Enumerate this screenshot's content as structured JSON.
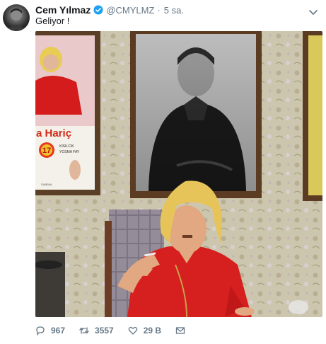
{
  "tweet": {
    "author_name": "Cem Yılmaz",
    "handle": "@CMYLMZ",
    "separator": "·",
    "time": "5 sa.",
    "text": "Geliyor !"
  },
  "media": {
    "poster_text_left": "a Hariç",
    "poster_number": "17",
    "poster_small_1": "KISILCIK",
    "poster_small_2": "YOSMA FAY",
    "poster_footer": "SINEMA"
  },
  "actions": {
    "replies": "967",
    "retweets": "3557",
    "likes": "29 B"
  },
  "icons": {
    "verified": "verified-badge-icon",
    "caret": "chevron-down-icon",
    "reply": "reply-icon",
    "retweet": "retweet-icon",
    "like": "heart-icon",
    "dm": "envelope-icon"
  },
  "colors": {
    "verified": "#1da1f2",
    "muted": "#657786",
    "shirt": "#d61f1f",
    "wig": "#e6c45a"
  }
}
